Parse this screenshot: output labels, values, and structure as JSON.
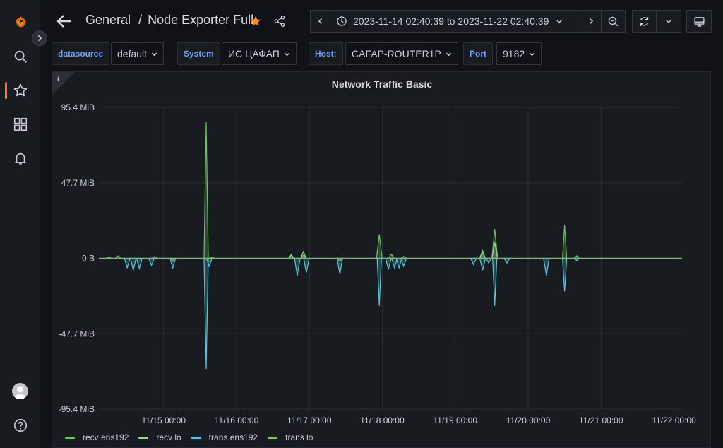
{
  "dashboard": {
    "breadcrumb_folder": "General",
    "separator": "/",
    "title": "Node Exporter Full",
    "starred": true
  },
  "time_range": {
    "label": "2023-11-14 02:40:39 to 2023-11-22 02:40:39"
  },
  "variables": [
    {
      "label": "datasource",
      "value": "default"
    },
    {
      "label": "System",
      "value": "ИС ЦАФАП"
    },
    {
      "label": "Host:",
      "value": "CAFAP-ROUTER1P"
    },
    {
      "label": "Port",
      "value": "9182"
    }
  ],
  "sidebar": {
    "items": [
      "grafana-logo",
      "search",
      "starred",
      "dashboards",
      "alerting"
    ],
    "bottom": [
      "profile",
      "help"
    ]
  },
  "panel": {
    "title": "Network Traffic Basic",
    "info_marker": "i"
  },
  "colors": {
    "recv_ens192": "#73bf69",
    "recv_lo": "#96d98d",
    "trans_ens192": "#5ac7d9",
    "trans_lo": "#8ac262",
    "accent": "#f55f3e",
    "star": "#ff8833"
  },
  "chart_data": {
    "type": "line",
    "title": "Network Traffic Basic",
    "xlabel": "",
    "ylabel": "",
    "y_unit": "MiB",
    "ylim": [
      -95.4,
      95.4
    ],
    "y_ticks": [
      "95.4 MiB",
      "47.7 MiB",
      "0 B",
      "-47.7 MiB",
      "-95.4 MiB"
    ],
    "y_tick_values": [
      95.4,
      47.7,
      0,
      -47.7,
      -95.4
    ],
    "x_ticks": [
      "11/15 00:00",
      "11/16 00:00",
      "11/17 00:00",
      "11/18 00:00",
      "11/19 00:00",
      "11/20 00:00",
      "11/21 00:00",
      "11/22 00:00"
    ],
    "x_range_days": [
      "2023-11-14 02:40",
      "2023-11-22 02:40"
    ],
    "legend_position": "bottom",
    "series": [
      {
        "name": "recv ens192",
        "color": "#73bf69",
        "points": [
          [
            "11/14 06:00",
            0.5
          ],
          [
            "11/14 09:00",
            1.5
          ],
          [
            "11/14 21:00",
            1.2
          ],
          [
            "11/15 14:00",
            86
          ],
          [
            "11/15 16:00",
            0.6
          ],
          [
            "11/16 18:00",
            2.4
          ],
          [
            "11/16 22:00",
            1.8
          ],
          [
            "11/17 23:00",
            15
          ],
          [
            "11/18 03:00",
            2.5
          ],
          [
            "11/18 07:00",
            1.2
          ],
          [
            "11/19 09:00",
            3.5
          ],
          [
            "11/19 13:00",
            18.5
          ],
          [
            "11/20 12:00",
            21
          ],
          [
            "11/20 16:00",
            1.6
          ]
        ]
      },
      {
        "name": "recv lo",
        "color": "#96d98d",
        "points": [
          [
            "11/16 18:00",
            2.0
          ],
          [
            "11/16 22:00",
            4.2
          ],
          [
            "11/19 09:00",
            4.8
          ],
          [
            "11/19 13:00",
            10
          ]
        ]
      },
      {
        "name": "trans ens192",
        "color": "#5ac7d9",
        "points": [
          [
            "11/14 12:00",
            -6
          ],
          [
            "11/14 14:00",
            -7.5
          ],
          [
            "11/14 16:00",
            -6.5
          ],
          [
            "11/14 20:00",
            -4.5
          ],
          [
            "11/15 03:00",
            -6
          ],
          [
            "11/15 14:00",
            -70
          ],
          [
            "11/15 15:00",
            -5
          ],
          [
            "11/16 20:00",
            -11
          ],
          [
            "11/16 23:00",
            -9
          ],
          [
            "11/17 10:00",
            -10
          ],
          [
            "11/17 23:00",
            -30
          ],
          [
            "11/18 02:00",
            -7
          ],
          [
            "11/18 04:00",
            -6
          ],
          [
            "11/18 05:30",
            -6
          ],
          [
            "11/18 07:00",
            -5
          ],
          [
            "11/19 06:00",
            -4
          ],
          [
            "11/19 09:00",
            -7.5
          ],
          [
            "11/19 11:00",
            -3
          ],
          [
            "11/19 13:00",
            -30
          ],
          [
            "11/19 17:00",
            -3
          ],
          [
            "11/20 06:00",
            -11
          ],
          [
            "11/20 12:00",
            -21
          ],
          [
            "11/20 16:00",
            -1.5
          ]
        ]
      },
      {
        "name": "trans lo",
        "color": "#8ac262",
        "points": [
          [
            "11/15 03:00",
            -1.5
          ],
          [
            "11/17 10:00",
            -2.0
          ]
        ]
      }
    ]
  }
}
